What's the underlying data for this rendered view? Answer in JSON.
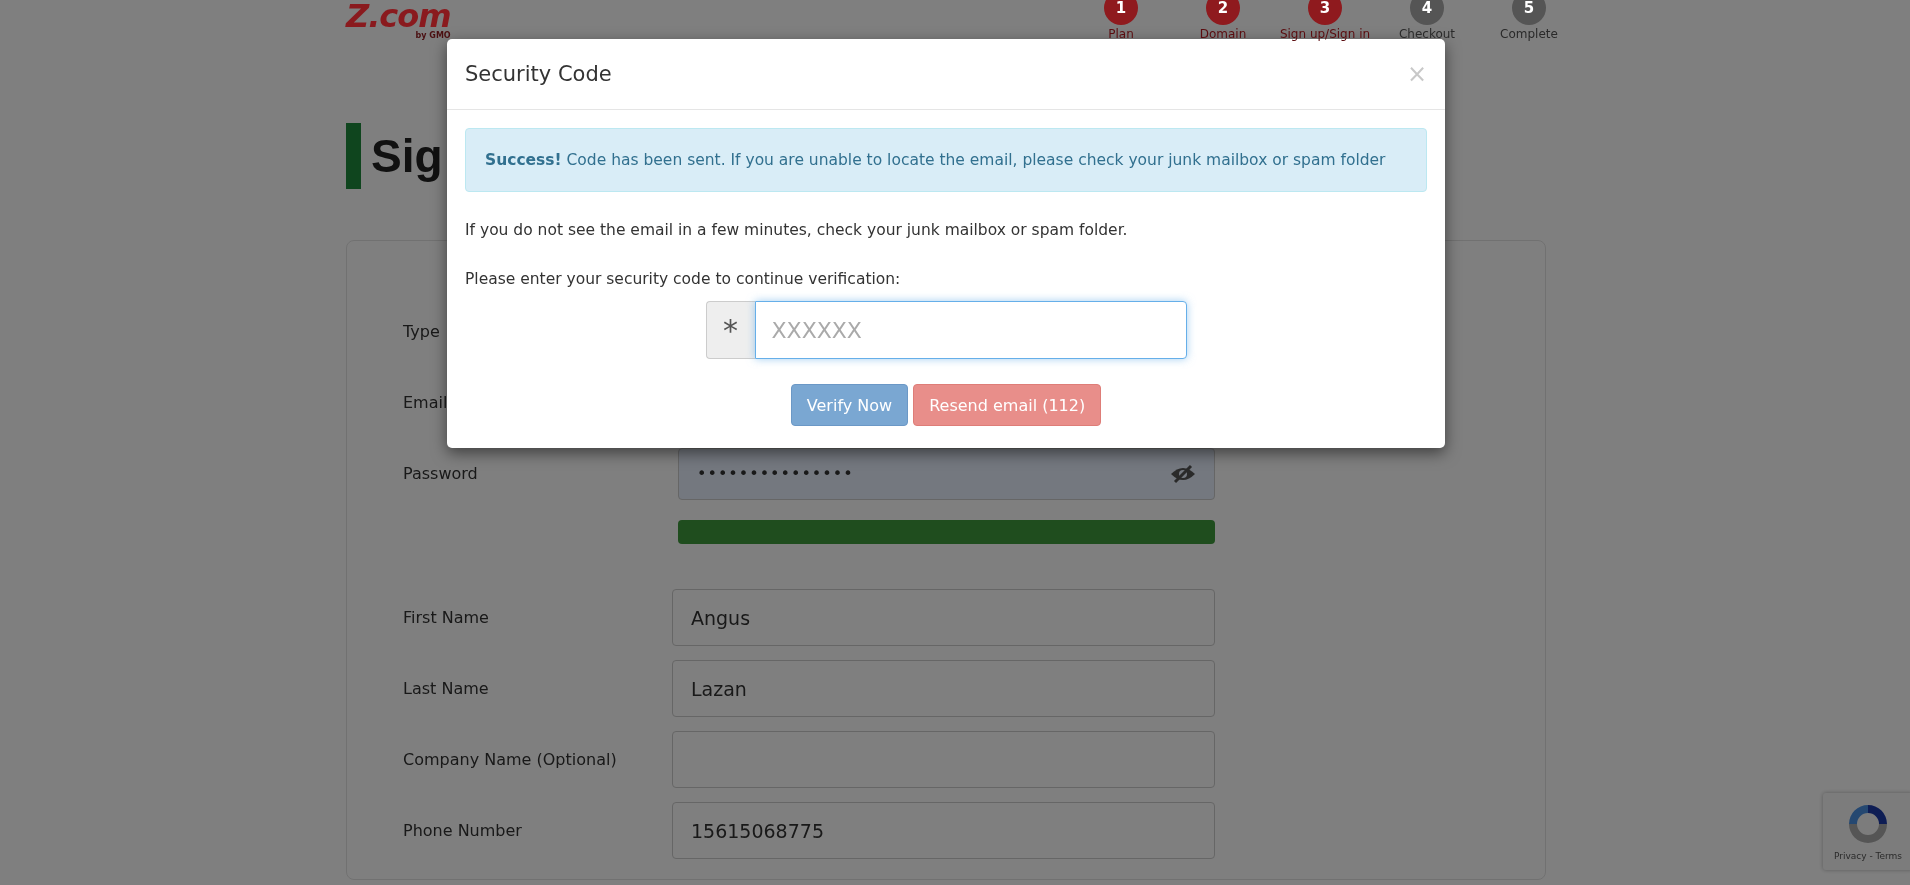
{
  "logo": {
    "name": "Z.com",
    "tagline": "by GMO"
  },
  "steps": [
    {
      "number": "1",
      "label": "Plan",
      "done": true
    },
    {
      "number": "2",
      "label": "Domain",
      "done": true
    },
    {
      "number": "3",
      "label": "Sign up/Sign in",
      "done": true
    },
    {
      "number": "4",
      "label": "Checkout",
      "done": false
    },
    {
      "number": "5",
      "label": "Complete",
      "done": false
    }
  ],
  "heading": "Sig",
  "form": {
    "fields": [
      {
        "kind": "hidden",
        "label": "Type"
      },
      {
        "kind": "hidden",
        "label": "Email"
      },
      {
        "kind": "password",
        "label": "Password",
        "value": "•••••••••••••••"
      },
      {
        "kind": "meter",
        "level": 1
      },
      {
        "kind": "text",
        "label": "First Name",
        "value": "Angus"
      },
      {
        "kind": "text",
        "label": "Last Name",
        "value": "Lazan"
      },
      {
        "kind": "text",
        "label": "Company Name (Optional)"
      },
      {
        "kind": "text",
        "label": "Phone Number",
        "value": "15615068775"
      }
    ]
  },
  "modal": {
    "title": "Security Code",
    "close": "×",
    "alert": "**Success!** Code has been sent. If you are unable to locate the email, please check your junk mailbox or spam folder",
    "note": "If you do not see the email in a few minutes, check your junk mailbox or spam folder.",
    "prompt": "Please enter your security code to continue verification:",
    "code_field": {
      "prefix": "*",
      "placeholder": "XXXXXX"
    },
    "buttons": [
      {
        "label": "Verify Now",
        "kind": "primary"
      },
      {
        "label": "Resend email (112)",
        "kind": "danger"
      }
    ]
  },
  "recaptcha": {
    "links": "Privacy - Terms"
  }
}
